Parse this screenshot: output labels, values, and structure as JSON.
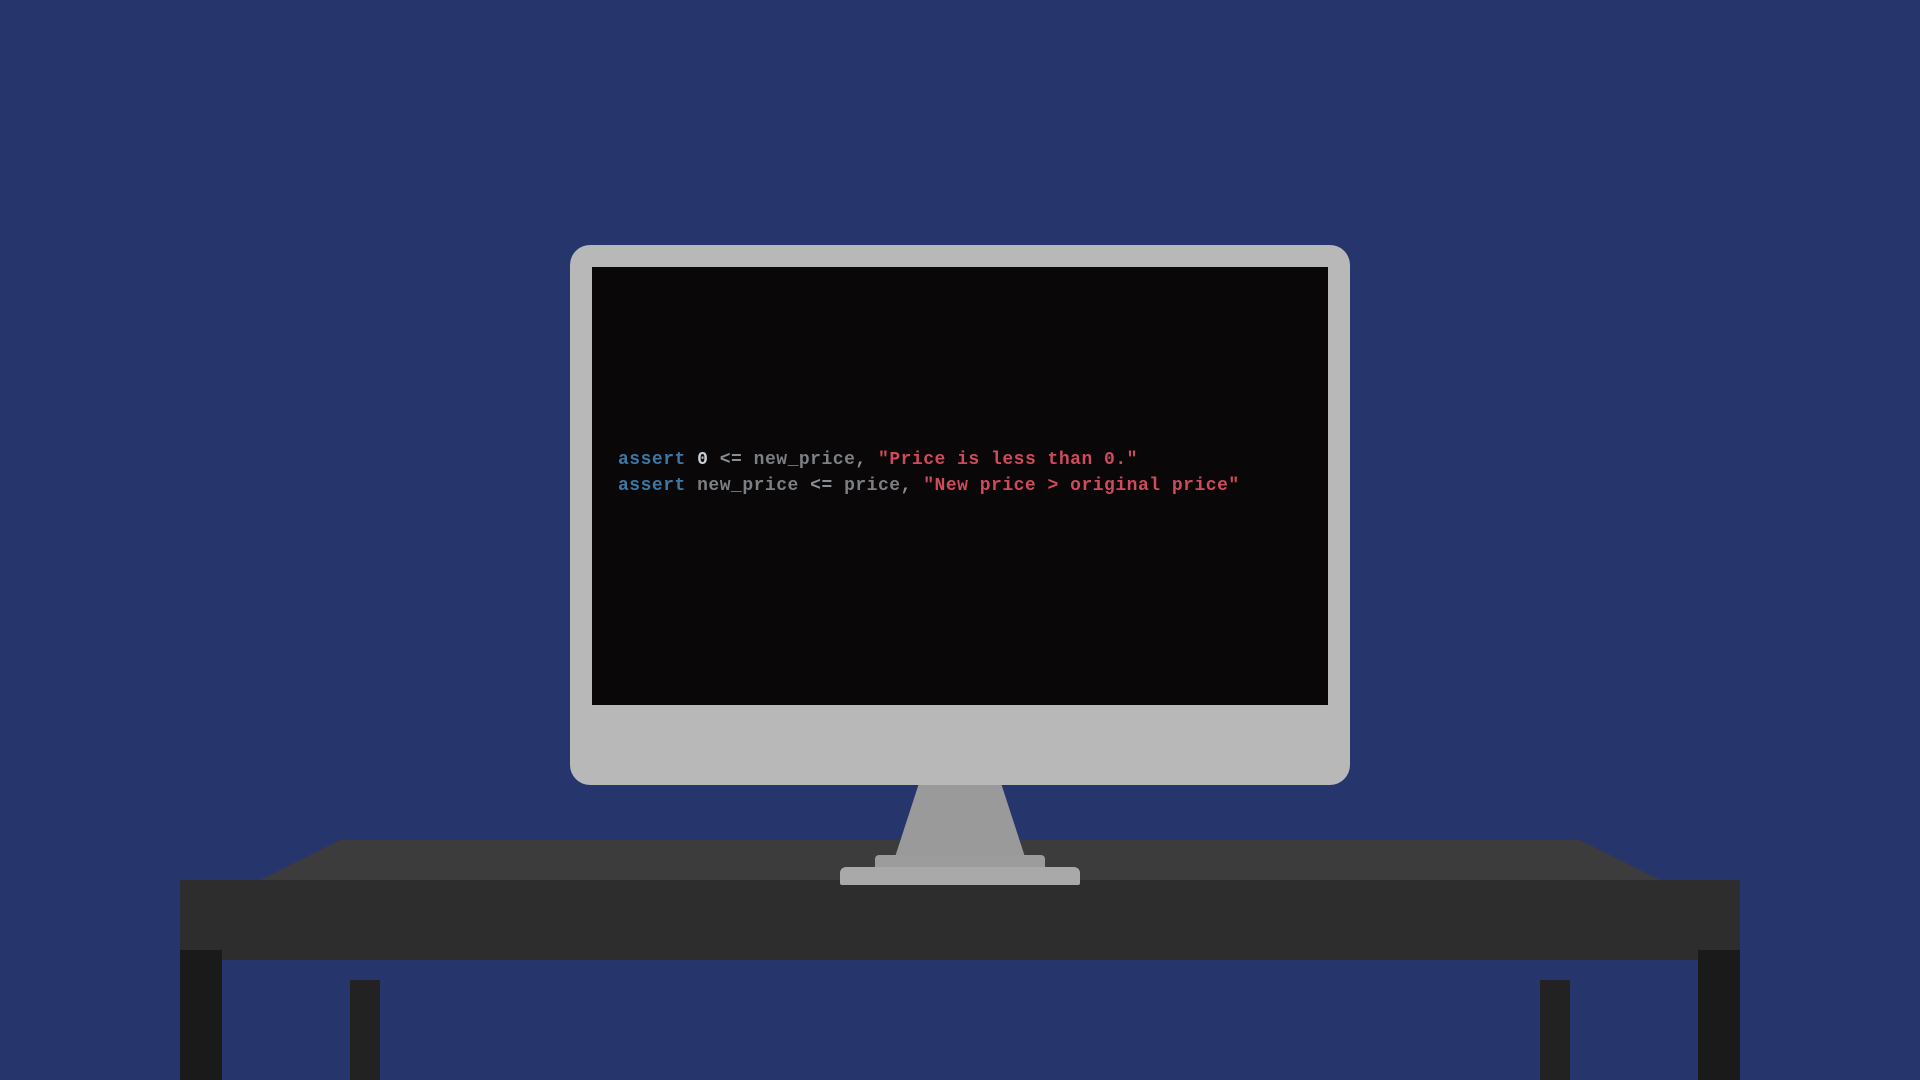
{
  "code": {
    "line1": {
      "kw": "assert",
      "s1": " ",
      "num": "0",
      "s2": " ",
      "op1": "<=",
      "s3": " ",
      "var": "new_price",
      "comma": ",",
      "s4": " ",
      "str": "\"Price is less than 0.\""
    },
    "line2": {
      "kw": "assert",
      "s1": " ",
      "var1": "new_price",
      "s2": " ",
      "op1": "<=",
      "s3": " ",
      "var2": "price",
      "comma": ",",
      "s4": " ",
      "str": "\"New price > original price\""
    }
  }
}
